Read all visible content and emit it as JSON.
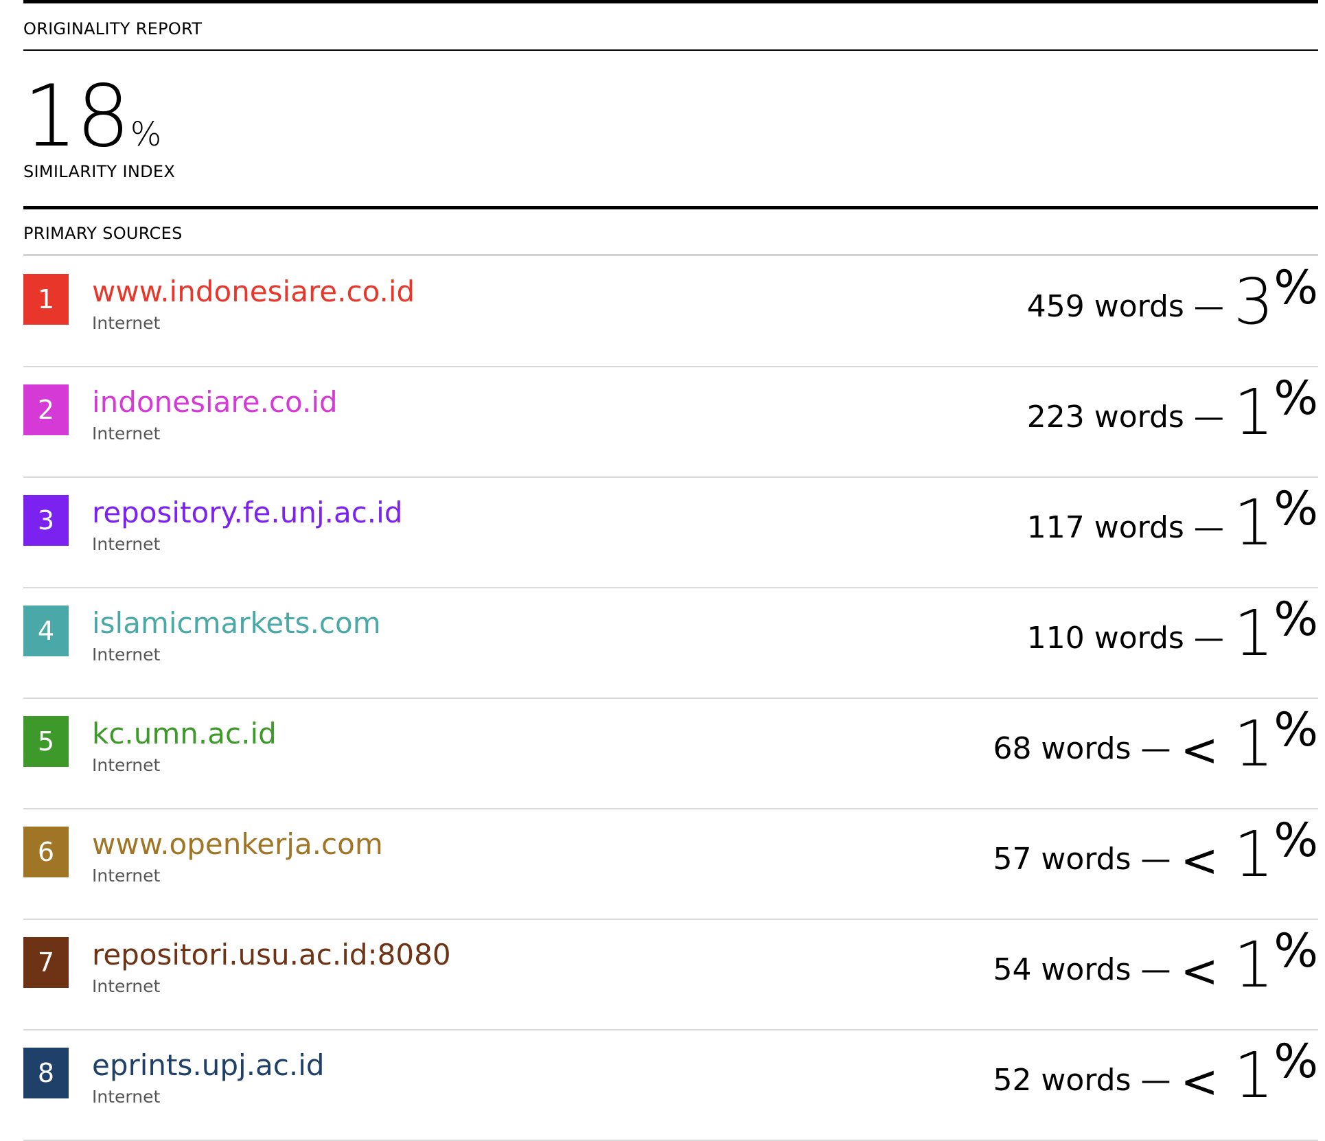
{
  "report": {
    "title": "ORIGINALITY REPORT",
    "similarity_value": "18",
    "similarity_symbol": "%",
    "similarity_label": "SIMILARITY INDEX",
    "sources_heading": "PRIMARY SOURCES"
  },
  "sources": [
    {
      "number": "1",
      "name": "www.indonesiare.co.id",
      "kind": "Internet",
      "words": "459 words",
      "dash": "—",
      "prefix": "",
      "percent": "3",
      "symbol": "%",
      "color": "#e8372a"
    },
    {
      "number": "2",
      "name": "indonesiare.co.id",
      "kind": "Internet",
      "words": "223 words",
      "dash": "—",
      "prefix": "",
      "percent": "1",
      "symbol": "%",
      "color": "#d63ad6"
    },
    {
      "number": "3",
      "name": "repository.fe.unj.ac.id",
      "kind": "Internet",
      "words": "117 words",
      "dash": "—",
      "prefix": "",
      "percent": "1",
      "symbol": "%",
      "color": "#7b22f0"
    },
    {
      "number": "4",
      "name": "islamicmarkets.com",
      "kind": "Internet",
      "words": "110 words",
      "dash": "—",
      "prefix": "",
      "percent": "1",
      "symbol": "%",
      "color": "#4aa8a8"
    },
    {
      "number": "5",
      "name": "kc.umn.ac.id",
      "kind": "Internet",
      "words": "68 words",
      "dash": "—",
      "prefix": "<",
      "percent": "1",
      "symbol": "%",
      "color": "#3d9a2a"
    },
    {
      "number": "6",
      "name": "www.openkerja.com",
      "kind": "Internet",
      "words": "57 words",
      "dash": "—",
      "prefix": "<",
      "percent": "1",
      "symbol": "%",
      "color": "#a07525"
    },
    {
      "number": "7",
      "name": "repositori.usu.ac.id:8080",
      "kind": "Internet",
      "words": "54 words",
      "dash": "—",
      "prefix": "<",
      "percent": "1",
      "symbol": "%",
      "color": "#6e3315"
    },
    {
      "number": "8",
      "name": "eprints.upj.ac.id",
      "kind": "Internet",
      "words": "52 words",
      "dash": "—",
      "prefix": "<",
      "percent": "1",
      "symbol": "%",
      "color": "#1f4069"
    }
  ]
}
